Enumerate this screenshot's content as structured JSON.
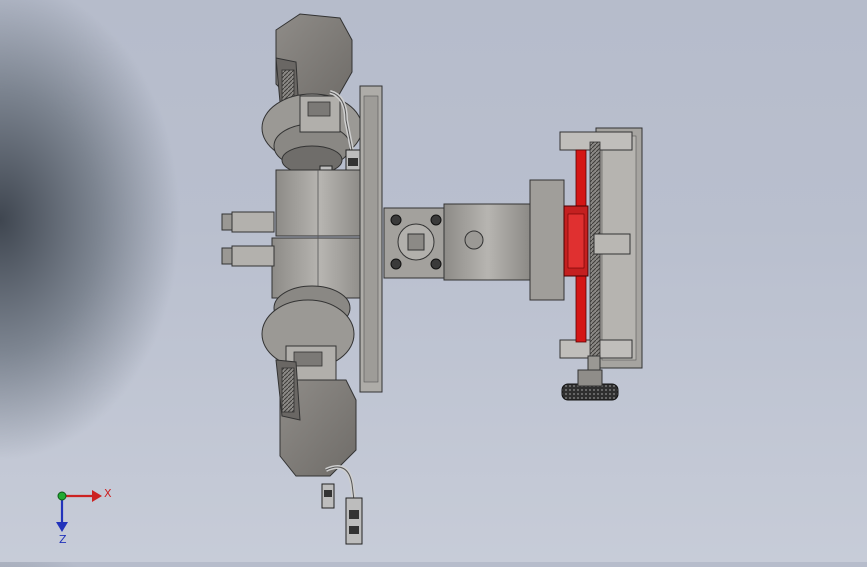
{
  "viewport": {
    "name": "cad-model-viewport",
    "background": "#b9bfce"
  },
  "triad": {
    "x_label": "X",
    "z_label": "Z",
    "x_color": "#cc2222",
    "z_color": "#2233bb",
    "y_color": "#22aa33"
  },
  "model": {
    "body_color": "#a9a7a3",
    "dark_color": "#6d6b68",
    "accent_color": "#d41616",
    "icons": [
      "servo-motor-icon",
      "lead-screw-icon",
      "knob-icon",
      "cable-connector-icon"
    ]
  }
}
